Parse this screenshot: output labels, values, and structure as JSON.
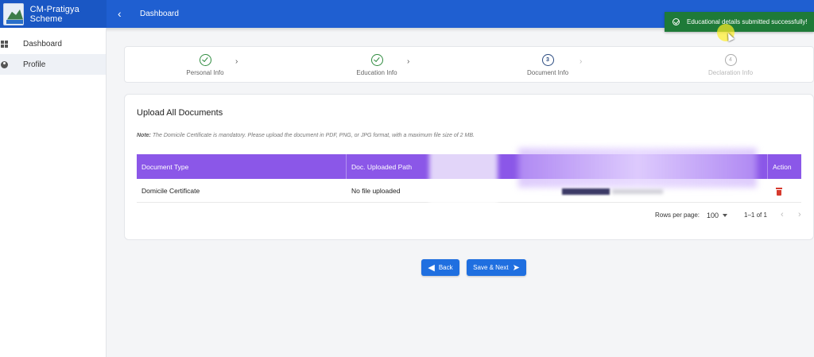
{
  "app": {
    "title": "CM-Pratigya Scheme",
    "header_title": "Dashboard"
  },
  "sidebar": {
    "items": [
      {
        "label": "Dashboard",
        "icon": "dashboard-grid-icon",
        "active": false
      },
      {
        "label": "Profile",
        "icon": "person-icon",
        "active": true
      }
    ]
  },
  "toast": {
    "message": "Educational details submitted successfully!",
    "color": "#1e7a38"
  },
  "stepper": {
    "steps": [
      {
        "label": "Personal Info",
        "state": "completed"
      },
      {
        "label": "Education Info",
        "state": "completed"
      },
      {
        "number": "3",
        "label": "Document Info",
        "state": "current"
      },
      {
        "number": "4",
        "label": "Declaration Info",
        "state": "upcoming"
      }
    ]
  },
  "documents": {
    "title": "Upload All Documents",
    "note_prefix": "Note:",
    "note_text": "The Domicile Certificate is mandatory. Please upload the document in PDF, PNG, or JPG format, with a maximum file size of 2 MB.",
    "columns": [
      "Document Type",
      "Doc. Uploaded Path",
      "Action"
    ],
    "rows": [
      {
        "document_type": "Domicile Certificate",
        "uploaded_path": "No file uploaded",
        "action": "delete-icon"
      }
    ],
    "header_color": "#8b57e8"
  },
  "pagination": {
    "rows_per_page_label": "Rows per page:",
    "rows_per_page": "100",
    "range": "1–1 of 1"
  },
  "buttons": {
    "back": "Back",
    "save_next": "Save & Next",
    "color": "#1f6fe0"
  }
}
